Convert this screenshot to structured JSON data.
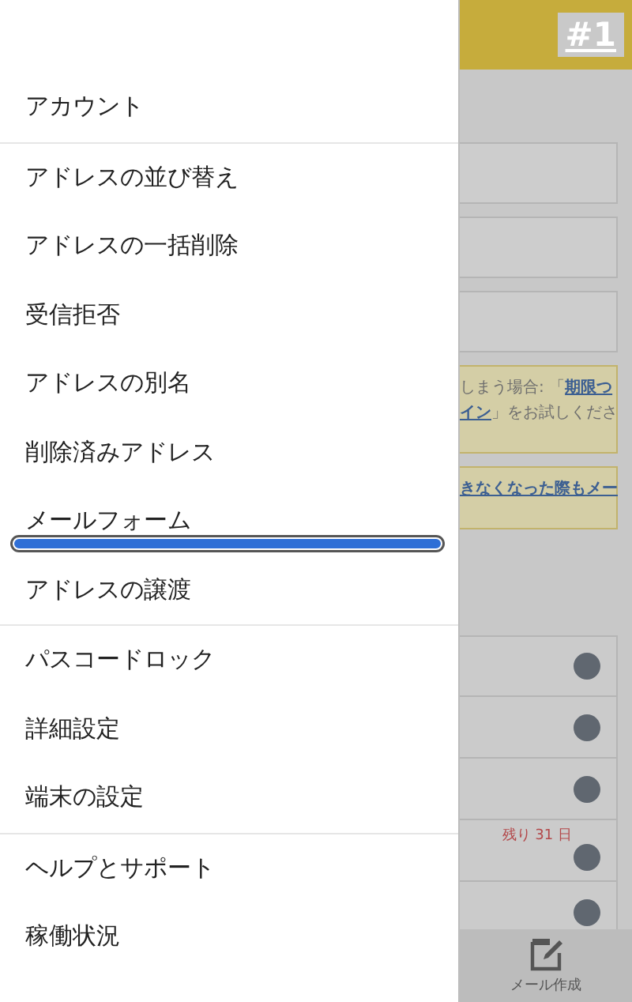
{
  "menu": {
    "groups": [
      {
        "items": [
          {
            "label": "アカウント",
            "highlighted": false
          }
        ]
      },
      {
        "items": [
          {
            "label": "アドレスの並び替え",
            "highlighted": false
          },
          {
            "label": "アドレスの一括削除",
            "highlighted": false
          },
          {
            "label": "受信拒否",
            "highlighted": false
          },
          {
            "label": "アドレスの別名",
            "highlighted": false
          },
          {
            "label": "削除済みアドレス",
            "highlighted": false
          },
          {
            "label": "メールフォーム",
            "highlighted": true
          },
          {
            "label": "アドレスの譲渡",
            "highlighted": false
          }
        ]
      },
      {
        "items": [
          {
            "label": "パスコードロック",
            "highlighted": false
          },
          {
            "label": "詳細設定",
            "highlighted": false
          },
          {
            "label": "端末の設定",
            "highlighted": false
          }
        ]
      },
      {
        "items": [
          {
            "label": "ヘルプとサポート",
            "highlighted": false
          },
          {
            "label": "稼働状況",
            "highlighted": false
          }
        ]
      }
    ]
  },
  "badge": "#1",
  "background": {
    "fields": [
      {
        "kind": "text"
      },
      {
        "kind": "text"
      },
      {
        "kind": "text"
      }
    ],
    "notices": [
      {
        "lines": [
          [
            {
              "text": "しまう場合: 「",
              "link": false
            },
            {
              "text": "期限つ",
              "link": true
            }
          ],
          [
            {
              "text": "イン",
              "link": true
            },
            {
              "text": "」をお試しくださ",
              "link": false
            }
          ]
        ]
      },
      {
        "lines": [
          [
            {
              "text": "きなくなった際もメー",
              "link": true
            }
          ]
        ]
      }
    ],
    "rows": [
      {
        "kind": "plain"
      },
      {
        "kind": "plain"
      },
      {
        "kind": "plain"
      },
      {
        "kind": "countdown",
        "remaining": "残り 31 日"
      },
      {
        "kind": "plain"
      }
    ],
    "compose_label": "メール作成"
  }
}
